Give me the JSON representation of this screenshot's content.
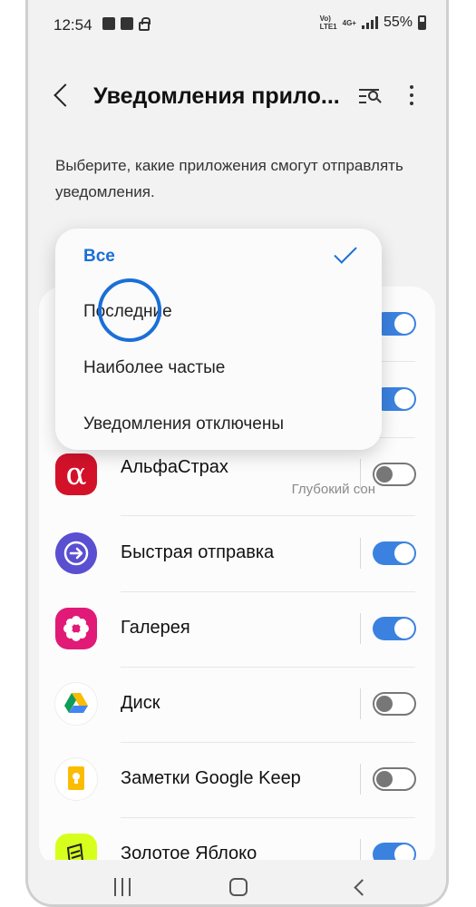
{
  "status_bar": {
    "time": "12:54",
    "net_top": "Vo)",
    "net_bottom": "LTE1",
    "net_type": "4G+",
    "battery": "55%"
  },
  "header": {
    "title": "Уведомления прило..."
  },
  "description": "Выберите, какие приложения смогут отправлять уведомления.",
  "dropdown": {
    "options": [
      {
        "label": "Все",
        "selected": true
      },
      {
        "label": "Последние",
        "selected": false
      },
      {
        "label": "Наиболее частые",
        "selected": false
      },
      {
        "label": "Уведомления отключены",
        "selected": false
      }
    ]
  },
  "apps": [
    {
      "name": "",
      "subtitle": "",
      "enabled": true,
      "icon": "hidden-app-icon"
    },
    {
      "name": "",
      "subtitle": "",
      "enabled": true,
      "icon": "hidden-app-icon"
    },
    {
      "name": "АльфаСтрах",
      "subtitle": "Глубокий сон",
      "enabled": false,
      "icon": "alfastrah-icon"
    },
    {
      "name": "Быстрая отправка",
      "subtitle": "",
      "enabled": true,
      "icon": "quick-share-icon"
    },
    {
      "name": "Галерея",
      "subtitle": "",
      "enabled": true,
      "icon": "gallery-icon"
    },
    {
      "name": "Диск",
      "subtitle": "",
      "enabled": false,
      "icon": "google-drive-icon"
    },
    {
      "name": "Заметки Google Keep",
      "subtitle": "",
      "enabled": false,
      "icon": "google-keep-icon"
    },
    {
      "name": "Золотое Яблоко",
      "subtitle": "",
      "enabled": true,
      "icon": "zoloto-yabloko-icon"
    }
  ],
  "colors": {
    "accent": "#1a6fd8",
    "toggle_on": "#3b82e0",
    "background": "#f2f2f2"
  }
}
